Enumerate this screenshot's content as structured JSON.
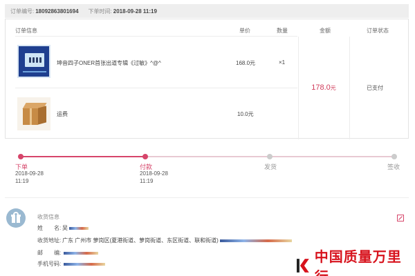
{
  "order": {
    "number_label": "订单编号:",
    "number": "18092863801694",
    "time_label": "下单时间:",
    "time": "2018-09-28 11:19"
  },
  "columns": {
    "info": "订单信息",
    "unit_price": "单价",
    "quantity": "数量",
    "amount": "金额",
    "status": "订单状态"
  },
  "items": [
    {
      "title": "坤音四子ONER首张出道专辑《过敏》^@^",
      "price": "168.0元",
      "qty": "×1",
      "image": "album-cover"
    },
    {
      "title": "运费",
      "price": "10.0元",
      "qty": "",
      "image": "package-box"
    }
  ],
  "total": {
    "amount": "178.0",
    "unit": "元"
  },
  "status": "已支付",
  "progress": {
    "completed_steps": 2,
    "steps": [
      {
        "label": "下单",
        "date": "2018-09-28",
        "time": "11:19",
        "done": true
      },
      {
        "label": "付款",
        "date": "2018-09-28",
        "time": "11:19",
        "done": true
      },
      {
        "label": "发货",
        "date": "",
        "time": "",
        "done": false
      },
      {
        "label": "签收",
        "date": "",
        "time": "",
        "done": false
      }
    ]
  },
  "shipping": {
    "title": "收货信息",
    "name_label": "姓　　名:",
    "name": "吴",
    "address_label": "收货地址:",
    "address": "广东 广州市 萝岗区(夏港街道、萝岗街道、东区街道、联和街道)",
    "postcode_label": "邮　　编:",
    "phone_label": "手机号码:"
  },
  "watermark": {
    "text": "中国质量万里行"
  },
  "colors": {
    "accent": "#d6456a",
    "price": "#d03b5a",
    "header_bg": "#eeeeee",
    "watermark": "#d7121c"
  }
}
